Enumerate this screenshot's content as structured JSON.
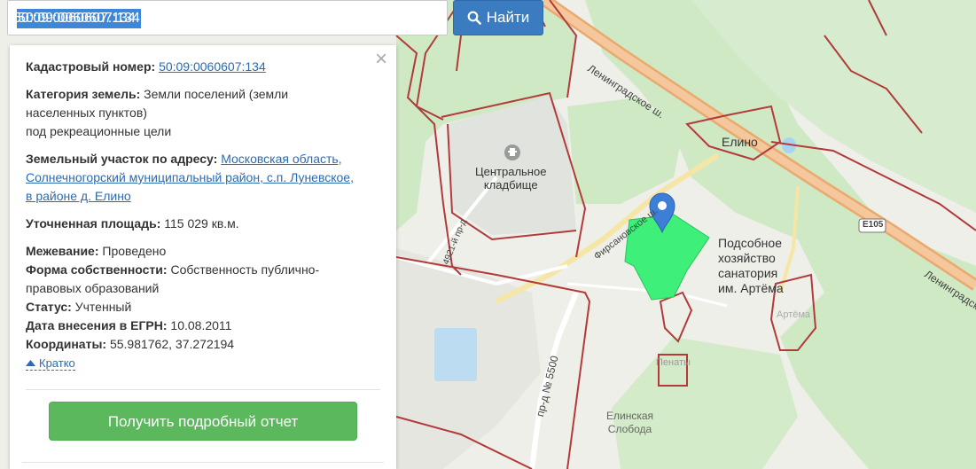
{
  "search": {
    "value": "50:09:0060607:134",
    "button_label": "Найти"
  },
  "info": {
    "cadastral": {
      "label": "Кадастровый номер:",
      "value": "50:09:0060607:134"
    },
    "category": {
      "label": "Категория земель:",
      "value_line1": "Земли поселений (земли",
      "value_line2": "населенных пунктов)",
      "value_line3": "под рекреационные цели"
    },
    "address": {
      "label": "Земельный участок по адресу:",
      "value_line1": "Московская область,",
      "value_line2": "Солнечногорский муниципальный район, с.п. Луневское,",
      "value_line3": "в районе д. Елино"
    },
    "area": {
      "label": "Уточненная площадь:",
      "value": "115 029 кв.м."
    },
    "survey": {
      "label": "Межевание:",
      "value": "Проведено"
    },
    "ownership": {
      "label": "Форма собственности:",
      "value_line1": "Собственность публично-",
      "value_line2": "правовых образований"
    },
    "status": {
      "label": "Статус:",
      "value": "Учтенный"
    },
    "egrn_date": {
      "label": "Дата внесения в ЕГРН:",
      "value": "10.08.2011"
    },
    "coords": {
      "label": "Координаты:",
      "value": "55.981762, 37.272194"
    },
    "collapse_label": "Кратко",
    "report_button": "Получить подробный отчет",
    "close_glyph": "×"
  },
  "map": {
    "labels": {
      "cemetery_line1": "Центральное",
      "cemetery_line2": "кладбище",
      "elino": "Елино",
      "farm_line1": "Подсобное",
      "farm_line2": "хозяйство",
      "farm_line3": "санатория",
      "farm_line4": "им. Артёма",
      "artema": "Артёма",
      "penaty": "Пенаты",
      "sloboda_line1": "Елинская",
      "sloboda_line2": "Слобода"
    },
    "roads": {
      "leningradskoe": "Ленинградское ш.",
      "leningradskoe_right": "Ленинградск",
      "firsanovskoe": "Фирсановское ш.",
      "proezd_4921": "4921-й пр-д",
      "proezd_5500": "пр-д № 5500",
      "e105": "E105"
    },
    "colors": {
      "parcel_fill": "#3ef07a",
      "boundary": "#b23a3a",
      "forest": "#cfe9c4",
      "main_road": "#f0b07a",
      "marker": "#3d7fd6"
    }
  },
  "icons": {
    "search": "search-icon",
    "close": "close-icon",
    "collapse": "triangle-up-icon",
    "marker": "map-marker-icon",
    "cemetery": "cemetery-icon"
  }
}
